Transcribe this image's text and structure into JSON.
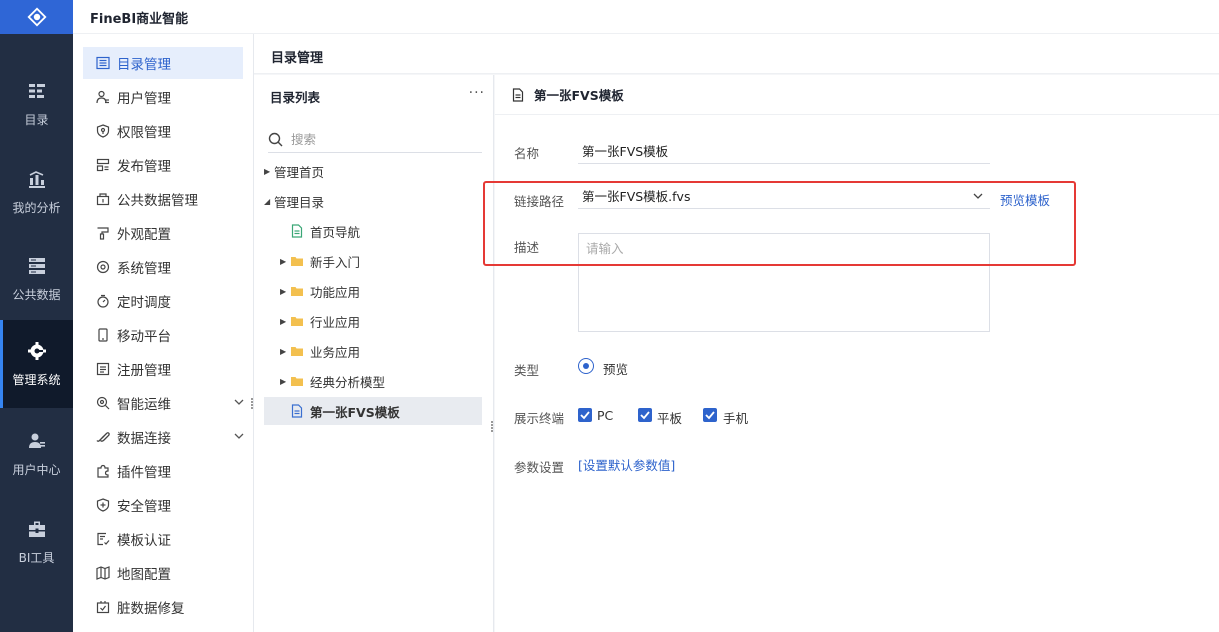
{
  "app": {
    "title": "FineBI商业智能"
  },
  "rail": {
    "items": [
      {
        "label": "目录",
        "icon": "catalog-icon"
      },
      {
        "label": "我的分析",
        "icon": "analysis-chart-icon"
      },
      {
        "label": "公共数据",
        "icon": "database-icon"
      },
      {
        "label": "管理系统",
        "icon": "gear-icon",
        "active": true
      },
      {
        "label": "用户中心",
        "icon": "user-icon"
      },
      {
        "label": "BI工具",
        "icon": "toolbox-icon"
      }
    ]
  },
  "menu": {
    "items": [
      {
        "label": "目录管理",
        "icon": "list-icon",
        "active": true
      },
      {
        "label": "用户管理",
        "icon": "user-manage-icon"
      },
      {
        "label": "权限管理",
        "icon": "shield-icon"
      },
      {
        "label": "发布管理",
        "icon": "publish-icon"
      },
      {
        "label": "公共数据管理",
        "icon": "public-data-icon"
      },
      {
        "label": "外观配置",
        "icon": "appearance-icon"
      },
      {
        "label": "系统管理",
        "icon": "settings-icon"
      },
      {
        "label": "定时调度",
        "icon": "timer-icon"
      },
      {
        "label": "移动平台",
        "icon": "mobile-icon"
      },
      {
        "label": "注册管理",
        "icon": "register-icon"
      },
      {
        "label": "智能运维",
        "icon": "ops-icon",
        "expandable": true
      },
      {
        "label": "数据连接",
        "icon": "link-icon",
        "expandable": true
      },
      {
        "label": "插件管理",
        "icon": "plugin-icon"
      },
      {
        "label": "安全管理",
        "icon": "security-icon"
      },
      {
        "label": "模板认证",
        "icon": "template-cert-icon"
      },
      {
        "label": "地图配置",
        "icon": "map-icon"
      },
      {
        "label": "脏数据修复",
        "icon": "repair-icon"
      }
    ]
  },
  "content": {
    "title": "目录管理"
  },
  "catalog": {
    "title": "目录列表",
    "more": "···",
    "search_placeholder": "搜索",
    "tree": [
      {
        "label": "管理首页",
        "level": 0,
        "type": "node",
        "arrow": "right"
      },
      {
        "label": "管理目录",
        "level": 0,
        "type": "node",
        "arrow": "down"
      },
      {
        "label": "首页导航",
        "level": 1,
        "type": "file"
      },
      {
        "label": "新手入门",
        "level": 1,
        "type": "folder",
        "arrow": "right"
      },
      {
        "label": "功能应用",
        "level": 1,
        "type": "folder",
        "arrow": "right"
      },
      {
        "label": "行业应用",
        "level": 1,
        "type": "folder",
        "arrow": "right"
      },
      {
        "label": "业务应用",
        "level": 1,
        "type": "folder",
        "arrow": "right"
      },
      {
        "label": "经典分析模型",
        "level": 1,
        "type": "folder",
        "arrow": "right"
      },
      {
        "label": "第一张FVS模板",
        "level": 1,
        "type": "file",
        "selected": true
      }
    ]
  },
  "detail": {
    "header": "第一张FVS模板",
    "name_label": "名称",
    "name_value": "第一张FVS模板",
    "path_label": "链接路径",
    "path_value": "第一张FVS模板.fvs",
    "preview_link": "预览模板",
    "desc_label": "描述",
    "desc_placeholder": "请输入",
    "type_label": "类型",
    "type_option": "预览",
    "terminal_label": "展示终端",
    "terminals": [
      "PC",
      "平板",
      "手机"
    ],
    "param_label": "参数设置",
    "param_link": "[设置默认参数值]"
  },
  "colors": {
    "brand": "#2f66d6",
    "rail_bg": "#222e43",
    "accent": "#2e63cc",
    "highlight": "#e53935"
  }
}
